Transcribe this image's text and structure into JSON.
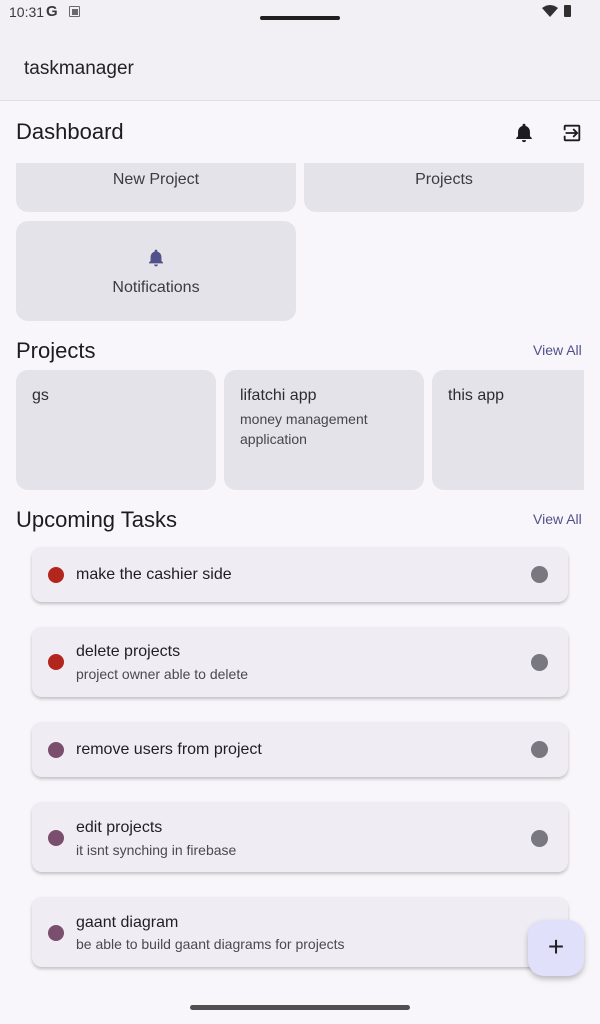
{
  "status_bar": {
    "time": "10:31",
    "google_icon_letter": "G"
  },
  "app_bar": {
    "title": "taskmanager"
  },
  "top_bar": {
    "title": "Dashboard",
    "notifications_icon": "bell-icon",
    "logout_icon": "logout-icon"
  },
  "quick_actions": [
    {
      "label": "New Project"
    },
    {
      "label": "Projects"
    },
    {
      "label": "Notifications",
      "icon": "bell-icon"
    }
  ],
  "projects_section": {
    "title": "Projects",
    "view_all": "View All",
    "items": [
      {
        "name": "gs",
        "description": ""
      },
      {
        "name": "lifatchi app",
        "description": "money management application"
      },
      {
        "name": "this app",
        "description": ""
      }
    ]
  },
  "tasks_section": {
    "title": "Upcoming Tasks",
    "view_all": "View All",
    "items": [
      {
        "title": "make the cashier side",
        "description": "",
        "priority_color": "#b3261e"
      },
      {
        "title": "delete projects",
        "description": "project owner able to delete",
        "priority_color": "#b3261e"
      },
      {
        "title": "remove users from project",
        "description": "",
        "priority_color": "#7a4f6e"
      },
      {
        "title": "edit projects",
        "description": "it isnt synching in firebase",
        "priority_color": "#7a4f6e"
      },
      {
        "title": "gaant diagram",
        "description": "be able to build gaant diagrams for projects",
        "priority_color": "#7a4f6e"
      }
    ]
  },
  "fab": {
    "icon": "plus-icon",
    "symbol": "+"
  },
  "colors": {
    "accent": "#50518a",
    "surface": "#e5e3ea",
    "background": "#f8f5fb"
  }
}
